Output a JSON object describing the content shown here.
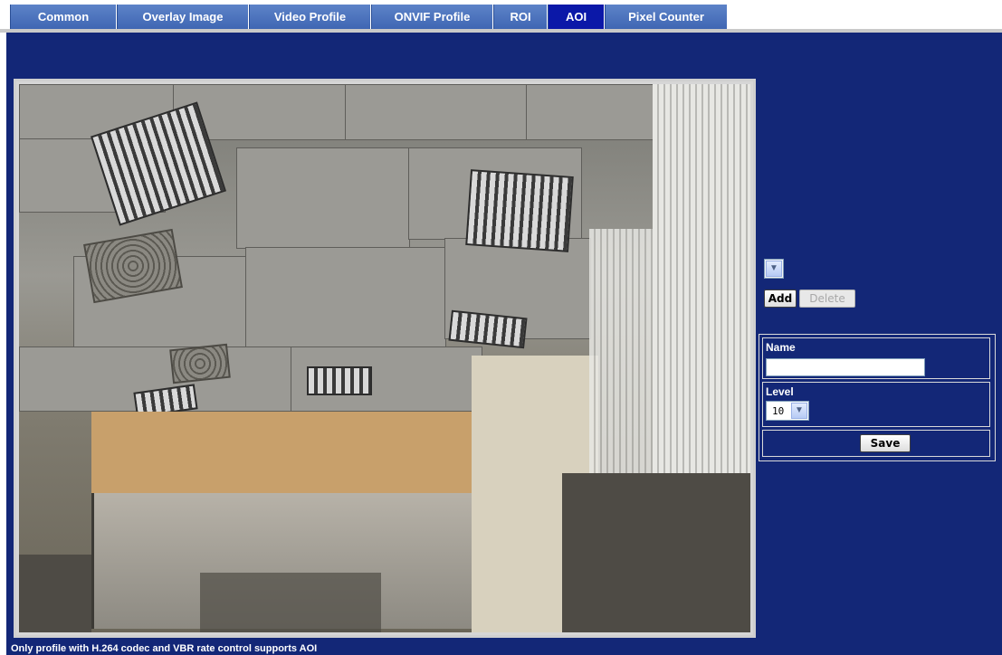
{
  "tabs": [
    {
      "label": "Common"
    },
    {
      "label": "Overlay Image"
    },
    {
      "label": "Video Profile"
    },
    {
      "label": "ONVIF Profile"
    },
    {
      "label": "ROI"
    },
    {
      "label": "AOI",
      "active": true
    },
    {
      "label": "Pixel Counter"
    }
  ],
  "aoi": {
    "add_label": "Add",
    "delete_label": "Delete",
    "name_label": "Name",
    "name_value": "",
    "level_label": "Level",
    "level_value": "10",
    "save_label": "Save"
  },
  "caption": "Only profile with H.264 codec and VBR rate control supports AOI",
  "colors": {
    "background": "#132777",
    "tab": "#4a71bd",
    "tab_active": "#0b18a8"
  },
  "icons": {
    "dropdown": "chevron-down-icon"
  }
}
